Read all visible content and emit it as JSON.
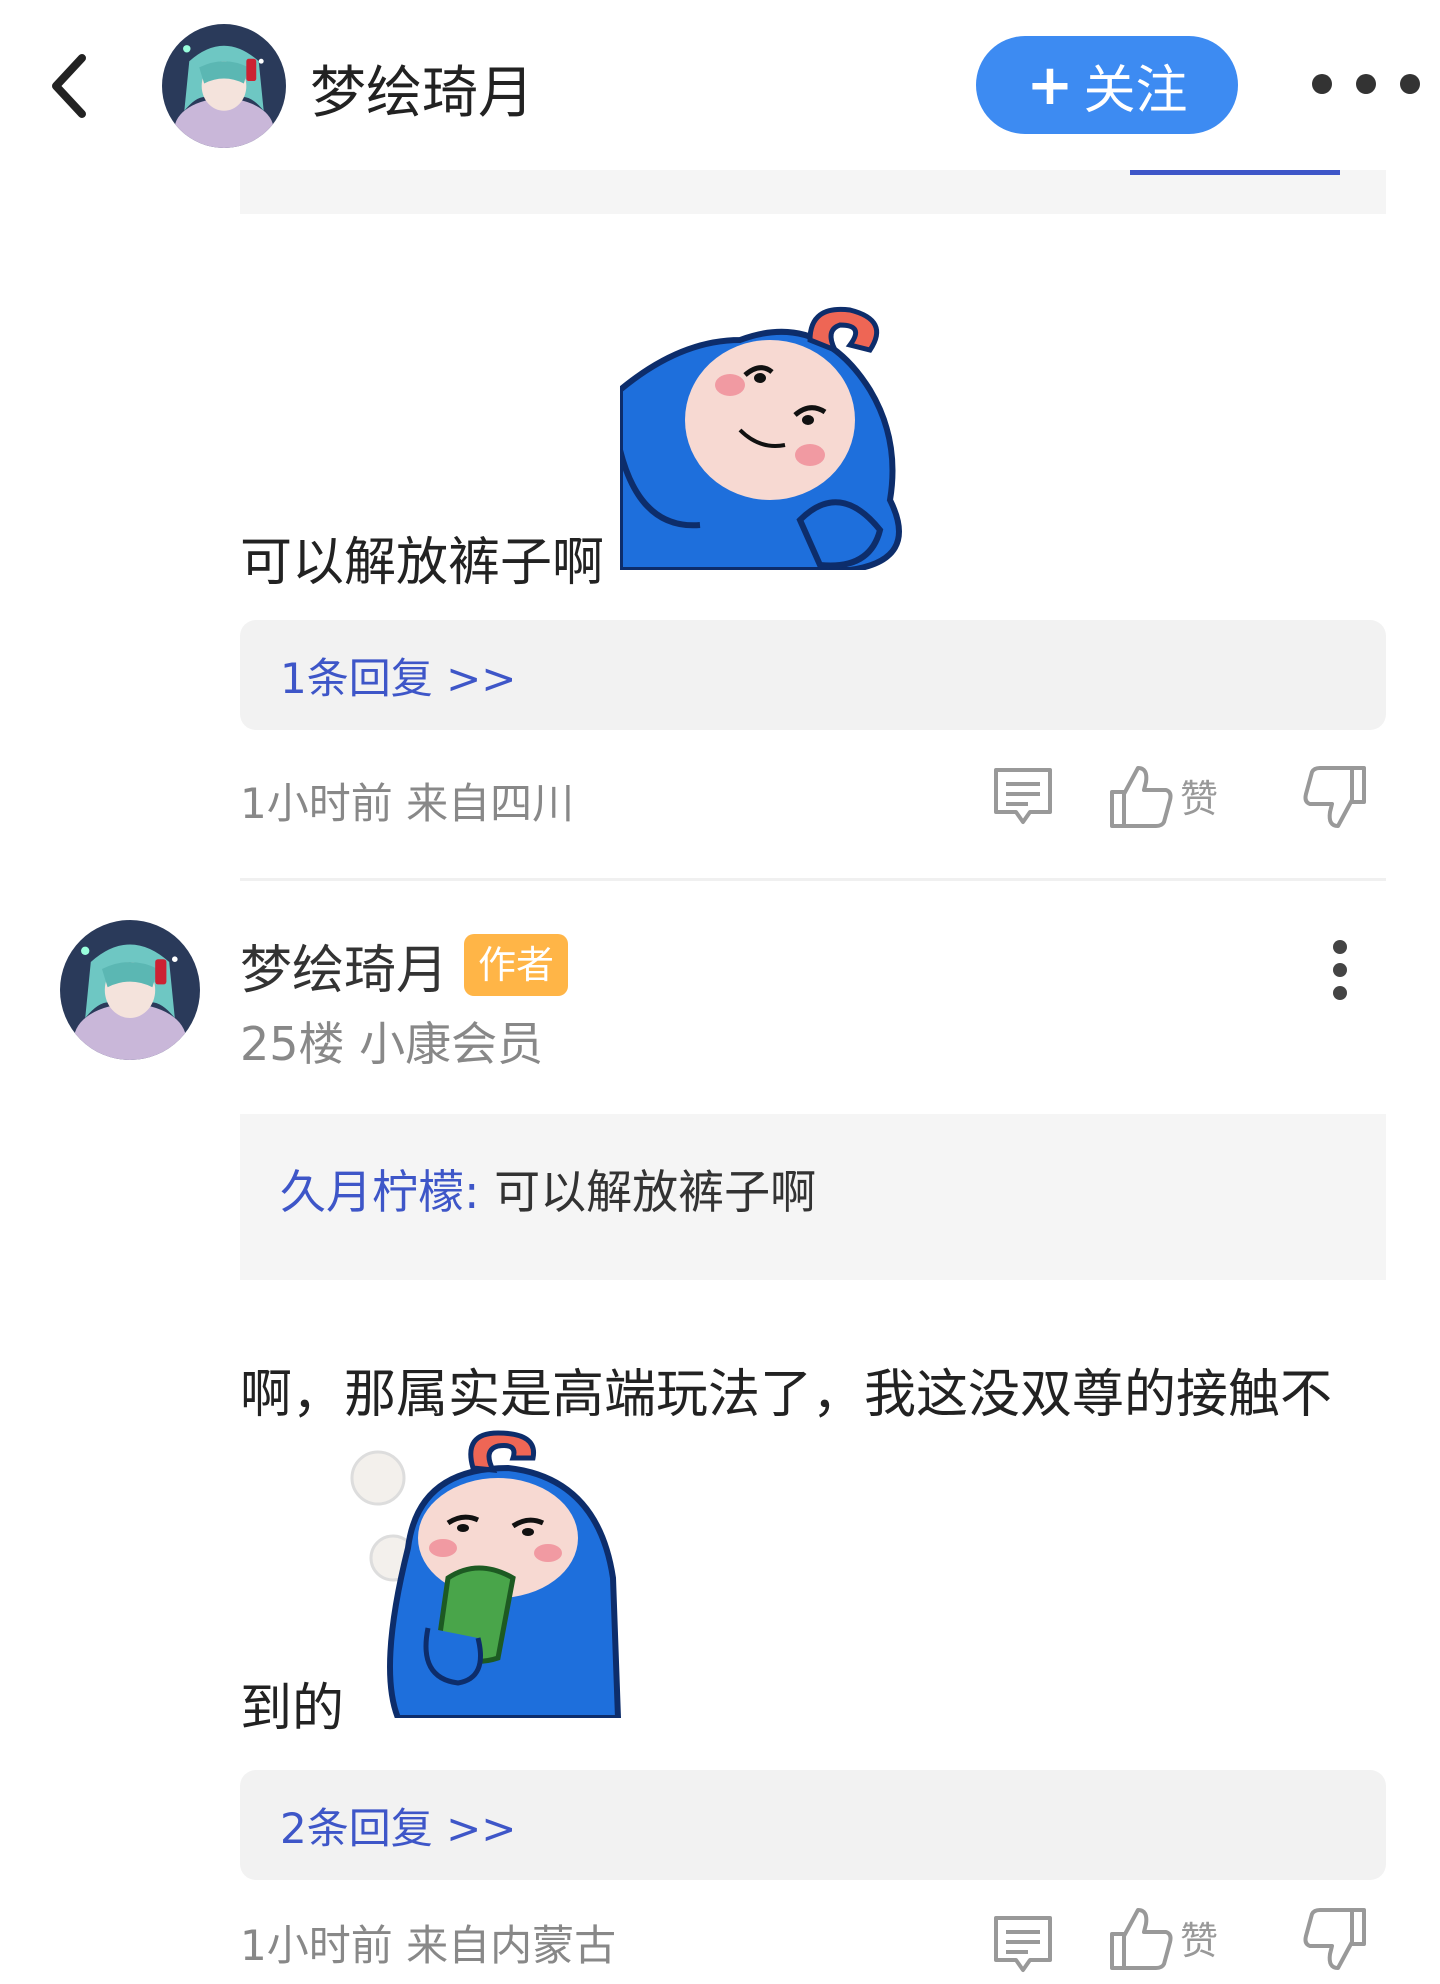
{
  "header": {
    "name": "梦绘琦月",
    "follow_label": "关注",
    "follow_plus": "+"
  },
  "comment1": {
    "text": "可以解放裤子啊",
    "replies_label": "1条回复 >>",
    "meta": "1小时前 来自四川",
    "like_label": "赞"
  },
  "comment2": {
    "user_name": "梦绘琦月",
    "author_tag": "作者",
    "floor_info": "25楼 小康会员",
    "quote_author": "久月柠檬:",
    "quote_text": "可以解放裤子啊",
    "text_line1": "啊，那属实是高端玩法了，我这没双尊的接触不",
    "text_line2": "到的",
    "replies_label": "2条回复 >>",
    "meta": "1小时前 来自内蒙古",
    "like_label": "赞"
  },
  "icons": {
    "back": "chevron-left-icon",
    "more": "more-dots-icon",
    "comment": "comment-icon",
    "like": "thumbs-up-icon",
    "dislike": "thumbs-down-icon",
    "kebab": "kebab-menu-icon"
  },
  "colors": {
    "follow_button": "#3d8bf2",
    "link_blue": "#3e56c8",
    "author_tag": "#ffb547",
    "sticker_blue": "#1e6fdc"
  }
}
